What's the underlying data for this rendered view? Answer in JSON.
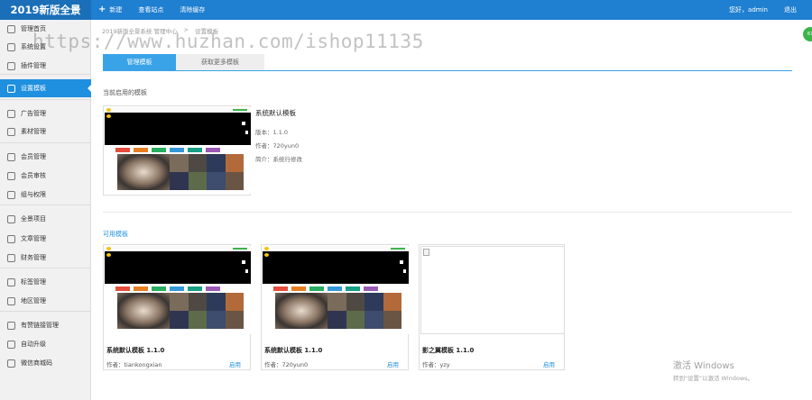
{
  "topbar": {
    "brand": "2019新版全景",
    "nav": [
      {
        "label": "新建",
        "icon": "plus-icon"
      },
      {
        "label": "查看站点",
        "icon": ""
      },
      {
        "label": "清除缓存",
        "icon": ""
      }
    ],
    "greeting": "您好，admin",
    "logout": "退出",
    "badge": "67"
  },
  "sidebar": {
    "items": [
      {
        "label": "管理首页",
        "icon": "home-icon",
        "active": false
      },
      {
        "label": "系统设置",
        "icon": "gear-icon",
        "active": false
      },
      {
        "label": "插件管理",
        "icon": "plug-icon",
        "active": false
      },
      {
        "label": "设置模板",
        "icon": "layout-icon",
        "active": true
      },
      {
        "label": "广告管理",
        "icon": "ad-icon",
        "active": false
      },
      {
        "label": "素材管理",
        "icon": "folder-icon",
        "active": false
      },
      {
        "label": "会员管理",
        "icon": "user-icon",
        "active": false
      },
      {
        "label": "会员审核",
        "icon": "user-check-icon",
        "active": false
      },
      {
        "label": "组与权限",
        "icon": "share-icon",
        "active": false
      },
      {
        "label": "全景项目",
        "icon": "grid-icon",
        "active": false
      },
      {
        "label": "文章管理",
        "icon": "document-icon",
        "active": false
      },
      {
        "label": "财务管理",
        "icon": "wallet-icon",
        "active": false
      },
      {
        "label": "标签管理",
        "icon": "tag-icon",
        "active": false
      },
      {
        "label": "地区管理",
        "icon": "location-icon",
        "active": false
      },
      {
        "label": "有赞链接管理",
        "icon": "link-icon",
        "active": false
      },
      {
        "label": "自动升级",
        "icon": "upgrade-icon",
        "active": false
      },
      {
        "label": "微信商城码",
        "icon": "qrcode-icon",
        "active": false
      }
    ]
  },
  "breadcrumb": [
    "2019新版全景系统 管理中心",
    "设置模板"
  ],
  "watermark": "https://www.huzhan.com/ishop11135",
  "tabs": [
    {
      "label": "管理模板",
      "active": true
    },
    {
      "label": "获取更多模板",
      "active": false
    }
  ],
  "current_section_title": "当前启用的模板",
  "current_template": {
    "name": "系统默认模板",
    "version_line": "版本：1.1.0",
    "author_line": "作者：720yun0",
    "intro_line": "简介：系统行修改"
  },
  "available_section_title": "可用模板",
  "available_templates": [
    {
      "name": "系统默认模板 1.1.0",
      "author": "作者：tiankongxian",
      "action": "启用"
    },
    {
      "name": "系统默认模板 1.1.0",
      "author": "作者：720yun0",
      "action": "启用"
    },
    {
      "name": "影之翼模板 1.1.0",
      "author": "作者：yzy",
      "action": "启用"
    }
  ],
  "windows_activation": {
    "title": "激活 Windows",
    "subtitle": "转到\"设置\"以激活 Windows。"
  },
  "colors": {
    "topbar": "#1f7fd0",
    "active_sidebar": "#1f8fe0",
    "tab_active": "#3aa3e8",
    "link": "#1f8fe0"
  }
}
